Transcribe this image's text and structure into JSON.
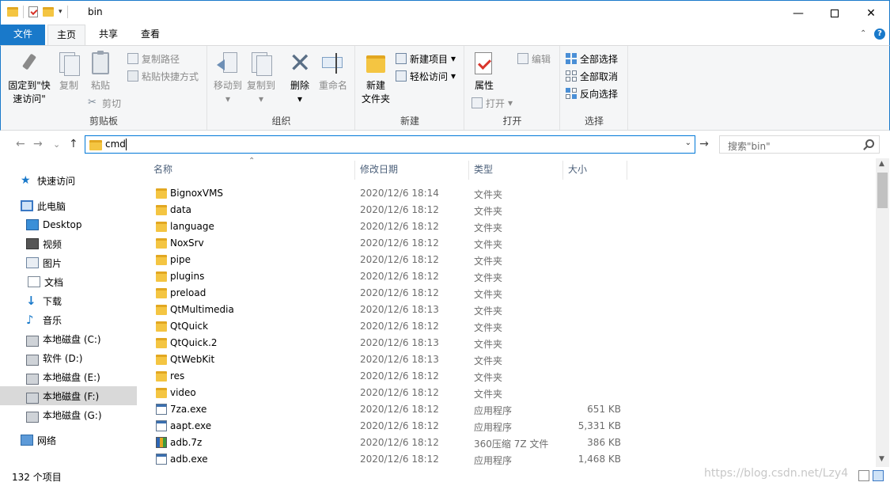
{
  "window": {
    "title": "bin",
    "min_glyph": "—",
    "close_glyph": "✕",
    "dropdown_glyph": "▾"
  },
  "ribbon_tabs": {
    "file": "文件",
    "home": "主页",
    "share": "共享",
    "view": "查看",
    "collapse_glyph": "⌃",
    "help_glyph": "?"
  },
  "clipboard": {
    "pin_label_1": "固定到\"快",
    "pin_label_2": "速访问\"",
    "copy": "复制",
    "paste": "粘贴",
    "copy_path": "复制路径",
    "paste_shortcut": "粘贴快捷方式",
    "cut": "剪切",
    "group_label": "剪贴板"
  },
  "organize": {
    "move_to": "移动到",
    "copy_to": "复制到",
    "delete": "删除",
    "rename": "重命名",
    "group_label": "组织"
  },
  "new_group": {
    "new_folder_1": "新建",
    "new_folder_2": "文件夹",
    "new_item": "新建项目",
    "easy_access": "轻松访问",
    "group_label": "新建"
  },
  "open_group": {
    "properties": "属性",
    "open": "打开",
    "edit": "编辑",
    "group_label": "打开"
  },
  "select_group": {
    "select_all": "全部选择",
    "select_none": "全部取消",
    "invert": "反向选择",
    "group_label": "选择"
  },
  "address_bar": {
    "value": "cmd",
    "back_glyph": "←",
    "forward_glyph": "→",
    "recent_glyph": "⌄",
    "up_glyph": "↑",
    "dropdown_glyph": "⌄",
    "go_glyph": "→"
  },
  "search": {
    "placeholder": "搜索\"bin\""
  },
  "nav_pane": {
    "quick_access": "快速访问",
    "this_pc": "此电脑",
    "desktop": "Desktop",
    "videos": "视频",
    "pictures": "图片",
    "documents": "文档",
    "downloads": "下载",
    "music": "音乐",
    "drive_c": "本地磁盘 (C:)",
    "drive_d": "软件 (D:)",
    "drive_e": "本地磁盘 (E:)",
    "drive_f": "本地磁盘 (F:)",
    "drive_g": "本地磁盘 (G:)",
    "network": "网络"
  },
  "columns": {
    "name": "名称",
    "date": "修改日期",
    "type": "类型",
    "size": "大小",
    "sort_glyph": "⌃"
  },
  "files": [
    {
      "name": "BignoxVMS",
      "date": "2020/12/6 18:14",
      "type": "文件夹",
      "size": "",
      "icon": "folder-icon"
    },
    {
      "name": "data",
      "date": "2020/12/6 18:12",
      "type": "文件夹",
      "size": "",
      "icon": "folder-icon"
    },
    {
      "name": "language",
      "date": "2020/12/6 18:12",
      "type": "文件夹",
      "size": "",
      "icon": "folder-icon"
    },
    {
      "name": "NoxSrv",
      "date": "2020/12/6 18:12",
      "type": "文件夹",
      "size": "",
      "icon": "folder-icon"
    },
    {
      "name": "pipe",
      "date": "2020/12/6 18:12",
      "type": "文件夹",
      "size": "",
      "icon": "folder-icon"
    },
    {
      "name": "plugins",
      "date": "2020/12/6 18:12",
      "type": "文件夹",
      "size": "",
      "icon": "folder-icon"
    },
    {
      "name": "preload",
      "date": "2020/12/6 18:12",
      "type": "文件夹",
      "size": "",
      "icon": "folder-icon"
    },
    {
      "name": "QtMultimedia",
      "date": "2020/12/6 18:13",
      "type": "文件夹",
      "size": "",
      "icon": "folder-icon"
    },
    {
      "name": "QtQuick",
      "date": "2020/12/6 18:12",
      "type": "文件夹",
      "size": "",
      "icon": "folder-icon"
    },
    {
      "name": "QtQuick.2",
      "date": "2020/12/6 18:13",
      "type": "文件夹",
      "size": "",
      "icon": "folder-icon"
    },
    {
      "name": "QtWebKit",
      "date": "2020/12/6 18:13",
      "type": "文件夹",
      "size": "",
      "icon": "folder-icon"
    },
    {
      "name": "res",
      "date": "2020/12/6 18:12",
      "type": "文件夹",
      "size": "",
      "icon": "folder-icon"
    },
    {
      "name": "video",
      "date": "2020/12/6 18:12",
      "type": "文件夹",
      "size": "",
      "icon": "folder-icon"
    },
    {
      "name": "7za.exe",
      "date": "2020/12/6 18:12",
      "type": "应用程序",
      "size": "651 KB",
      "icon": "exe-icon"
    },
    {
      "name": "aapt.exe",
      "date": "2020/12/6 18:12",
      "type": "应用程序",
      "size": "5,331 KB",
      "icon": "exe-icon"
    },
    {
      "name": "adb.7z",
      "date": "2020/12/6 18:12",
      "type": "360压缩 7Z 文件",
      "size": "386 KB",
      "icon": "archive-icon"
    },
    {
      "name": "adb.exe",
      "date": "2020/12/6 18:12",
      "type": "应用程序",
      "size": "1,468 KB",
      "icon": "exe-icon"
    }
  ],
  "scrollbar": {
    "up_glyph": "▲",
    "down_glyph": "▼"
  },
  "status_bar": {
    "item_count": "132 个项目",
    "watermark": "https://blog.csdn.net/Lzy4"
  },
  "colors": {
    "accent": "#1979ca",
    "folder": "#f4c542",
    "selection": "#d9d9d9"
  }
}
